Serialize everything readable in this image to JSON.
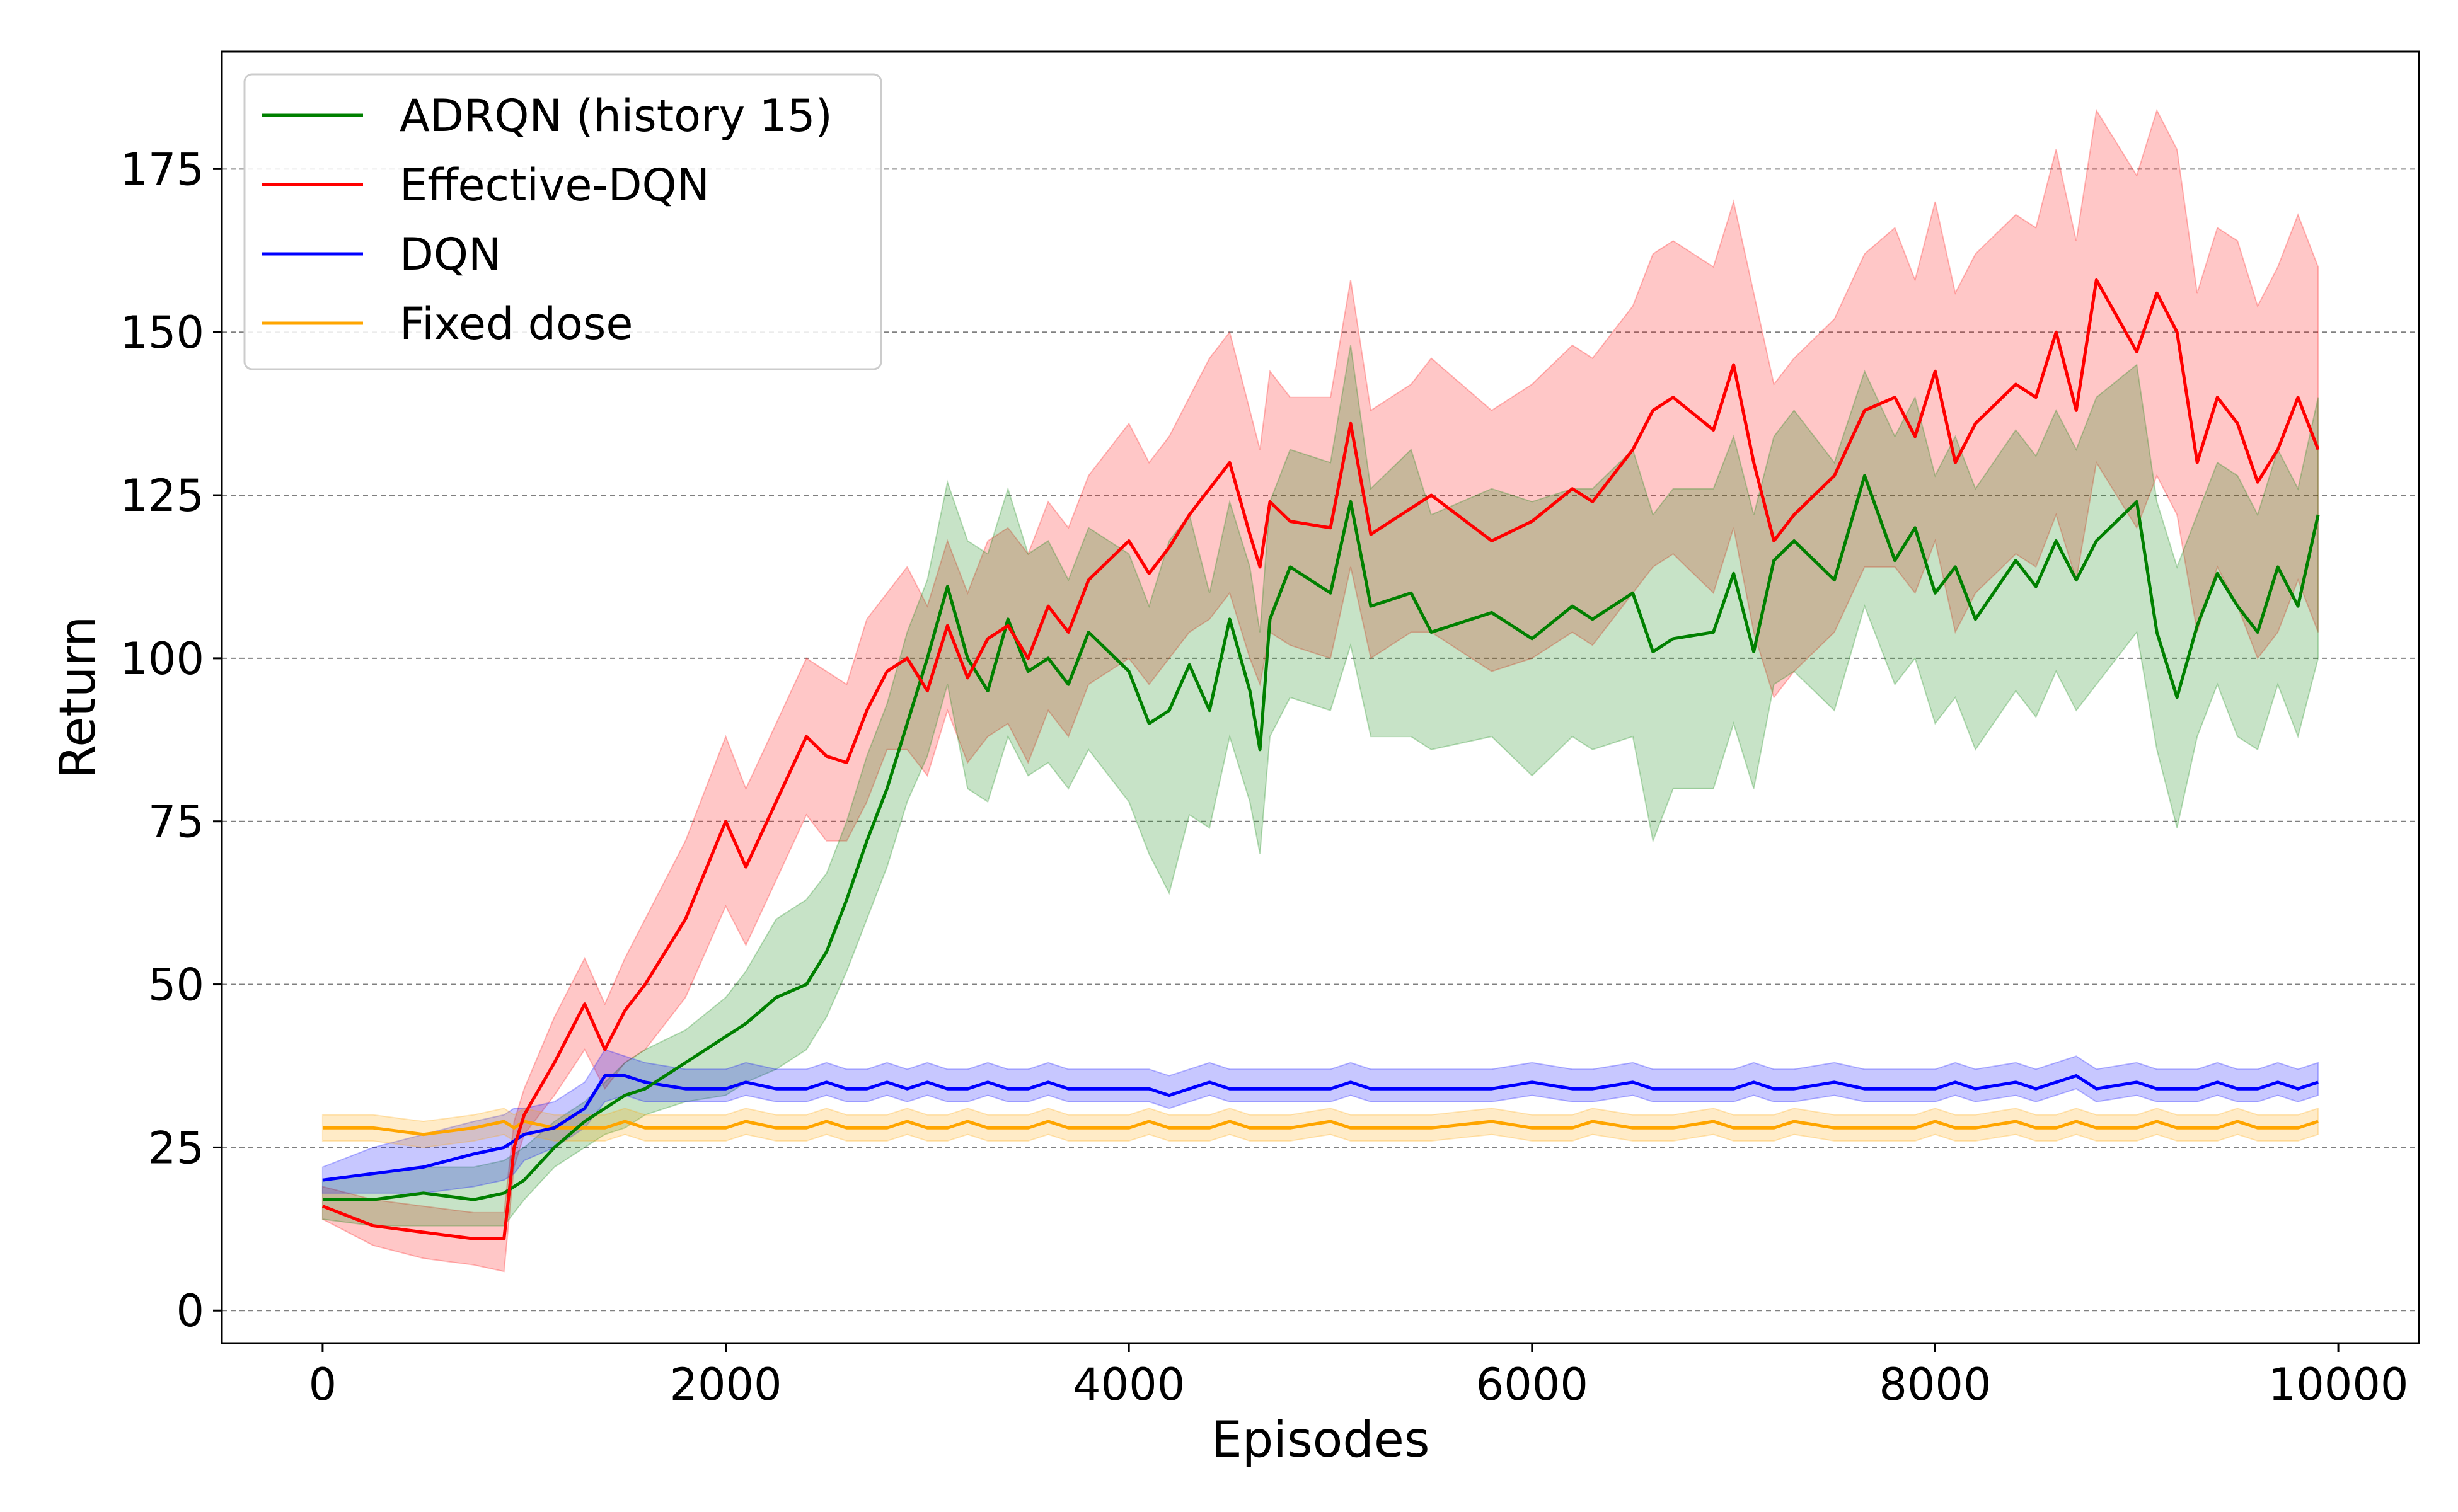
{
  "chart_data": {
    "type": "line",
    "title": "",
    "xlabel": "Episodes",
    "ylabel": "Return",
    "xlim": [
      -500,
      10400
    ],
    "ylim": [
      -5,
      193
    ],
    "xticks": [
      0,
      2000,
      4000,
      6000,
      8000,
      10000
    ],
    "xtick_labels": [
      "0",
      "2000",
      "4000",
      "6000",
      "8000",
      "10000"
    ],
    "yticks": [
      0,
      25,
      50,
      75,
      100,
      125,
      150,
      175
    ],
    "ytick_labels": [
      "0",
      "25",
      "50",
      "75",
      "100",
      "125",
      "150",
      "175"
    ],
    "grid": "horizontal dashed",
    "legend_position": "top-left",
    "x": [
      0,
      250,
      500,
      750,
      900,
      950,
      1000,
      1150,
      1300,
      1400,
      1500,
      1600,
      1800,
      2000,
      2100,
      2250,
      2400,
      2500,
      2600,
      2700,
      2800,
      2900,
      3000,
      3100,
      3200,
      3300,
      3400,
      3500,
      3600,
      3700,
      3800,
      4000,
      4100,
      4200,
      4300,
      4400,
      4500,
      4600,
      4650,
      4700,
      4800,
      5000,
      5100,
      5200,
      5400,
      5500,
      5800,
      6000,
      6200,
      6300,
      6500,
      6600,
      6700,
      6900,
      7000,
      7100,
      7200,
      7300,
      7500,
      7650,
      7800,
      7900,
      8000,
      8100,
      8200,
      8400,
      8500,
      8600,
      8700,
      8800,
      9000,
      9100,
      9200,
      9300,
      9400,
      9500,
      9600,
      9700,
      9800,
      9900
    ],
    "series": [
      {
        "name": "ADRQN (history 15)",
        "color": "#008000",
        "values": [
          17,
          17,
          18,
          17,
          18,
          19,
          20,
          25,
          29,
          31,
          33,
          34,
          38,
          42,
          44,
          48,
          50,
          55,
          63,
          72,
          80,
          90,
          100,
          111,
          100,
          95,
          106,
          98,
          100,
          96,
          104,
          98,
          90,
          92,
          99,
          92,
          106,
          95,
          86,
          106,
          114,
          110,
          124,
          108,
          110,
          104,
          107,
          103,
          108,
          106,
          110,
          101,
          103,
          104,
          113,
          101,
          115,
          118,
          112,
          128,
          115,
          120,
          110,
          114,
          106,
          115,
          111,
          118,
          112,
          118,
          124,
          104,
          94,
          105,
          113,
          108,
          104,
          114,
          108,
          122
        ],
        "lower": [
          14,
          13,
          13,
          13,
          13,
          15,
          17,
          22,
          25,
          27,
          28,
          30,
          32,
          33,
          35,
          37,
          40,
          45,
          52,
          60,
          68,
          78,
          85,
          96,
          80,
          78,
          88,
          82,
          84,
          80,
          86,
          78,
          70,
          64,
          76,
          74,
          88,
          78,
          70,
          88,
          94,
          92,
          102,
          88,
          88,
          86,
          88,
          82,
          88,
          86,
          88,
          72,
          80,
          80,
          90,
          80,
          96,
          98,
          92,
          108,
          96,
          100,
          90,
          94,
          86,
          95,
          91,
          98,
          92,
          96,
          104,
          86,
          74,
          88,
          96,
          88,
          86,
          96,
          88,
          100
        ],
        "upper": [
          20,
          21,
          22,
          22,
          23,
          24,
          25,
          29,
          32,
          35,
          38,
          40,
          43,
          48,
          52,
          60,
          63,
          67,
          75,
          85,
          93,
          104,
          112,
          127,
          118,
          116,
          126,
          116,
          118,
          112,
          120,
          116,
          108,
          118,
          122,
          110,
          124,
          114,
          104,
          124,
          132,
          130,
          148,
          126,
          132,
          122,
          126,
          124,
          126,
          126,
          132,
          122,
          126,
          126,
          134,
          122,
          134,
          138,
          130,
          144,
          134,
          140,
          128,
          134,
          126,
          135,
          131,
          138,
          132,
          140,
          145,
          124,
          114,
          122,
          130,
          128,
          122,
          132,
          126,
          140
        ]
      },
      {
        "name": "Effective-DQN",
        "color": "#ff0000",
        "values": [
          16,
          13,
          12,
          11,
          11,
          25,
          30,
          38,
          47,
          40,
          46,
          50,
          60,
          75,
          68,
          78,
          88,
          85,
          84,
          92,
          98,
          100,
          95,
          105,
          97,
          103,
          105,
          100,
          108,
          104,
          112,
          118,
          113,
          117,
          122,
          126,
          130,
          119,
          114,
          124,
          121,
          120,
          136,
          119,
          123,
          125,
          118,
          121,
          126,
          124,
          132,
          138,
          140,
          135,
          145,
          130,
          118,
          122,
          128,
          138,
          140,
          134,
          144,
          130,
          136,
          142,
          140,
          150,
          138,
          158,
          147,
          156,
          150,
          130,
          140,
          136,
          127,
          132,
          140,
          132
        ],
        "lower": [
          14,
          10,
          8,
          7,
          6,
          22,
          27,
          33,
          40,
          34,
          38,
          40,
          48,
          62,
          56,
          66,
          76,
          72,
          72,
          78,
          86,
          86,
          82,
          92,
          84,
          88,
          90,
          84,
          92,
          88,
          96,
          100,
          96,
          100,
          104,
          106,
          110,
          100,
          96,
          104,
          102,
          100,
          114,
          100,
          104,
          104,
          98,
          100,
          104,
          102,
          110,
          114,
          116,
          110,
          120,
          104,
          94,
          98,
          104,
          114,
          114,
          110,
          118,
          104,
          110,
          116,
          114,
          122,
          112,
          130,
          120,
          128,
          122,
          104,
          114,
          108,
          100,
          104,
          112,
          104
        ],
        "upper": [
          19,
          17,
          16,
          15,
          15,
          29,
          34,
          45,
          54,
          47,
          54,
          60,
          72,
          88,
          80,
          90,
          100,
          98,
          96,
          106,
          110,
          114,
          108,
          118,
          110,
          118,
          120,
          116,
          124,
          120,
          128,
          136,
          130,
          134,
          140,
          146,
          150,
          138,
          132,
          144,
          140,
          140,
          158,
          138,
          142,
          146,
          138,
          142,
          148,
          146,
          154,
          162,
          164,
          160,
          170,
          156,
          142,
          146,
          152,
          162,
          166,
          158,
          170,
          156,
          162,
          168,
          166,
          178,
          164,
          184,
          174,
          184,
          178,
          156,
          166,
          164,
          154,
          160,
          168,
          160
        ]
      },
      {
        "name": "DQN",
        "color": "#0000ff",
        "values": [
          20,
          21,
          22,
          24,
          25,
          26,
          27,
          28,
          31,
          36,
          36,
          35,
          34,
          34,
          35,
          34,
          34,
          35,
          34,
          34,
          35,
          34,
          35,
          34,
          34,
          35,
          34,
          34,
          35,
          34,
          34,
          34,
          34,
          33,
          34,
          35,
          34,
          34,
          34,
          34,
          34,
          34,
          35,
          34,
          34,
          34,
          34,
          35,
          34,
          34,
          35,
          34,
          34,
          34,
          34,
          35,
          34,
          34,
          35,
          34,
          34,
          34,
          34,
          35,
          34,
          35,
          34,
          35,
          36,
          34,
          35,
          34,
          34,
          34,
          35,
          34,
          34,
          35,
          34,
          35
        ],
        "lower": [
          18,
          18,
          18,
          19,
          20,
          21,
          23,
          25,
          28,
          32,
          33,
          32,
          32,
          32,
          33,
          32,
          32,
          33,
          32,
          32,
          33,
          32,
          33,
          32,
          32,
          33,
          32,
          32,
          33,
          32,
          32,
          32,
          32,
          31,
          32,
          33,
          32,
          32,
          32,
          32,
          32,
          32,
          33,
          32,
          32,
          32,
          32,
          33,
          32,
          32,
          33,
          32,
          32,
          32,
          32,
          33,
          32,
          32,
          33,
          32,
          32,
          32,
          32,
          33,
          32,
          33,
          32,
          33,
          34,
          32,
          33,
          32,
          32,
          32,
          33,
          32,
          32,
          33,
          32,
          33
        ],
        "upper": [
          22,
          25,
          27,
          29,
          30,
          31,
          31,
          32,
          35,
          40,
          39,
          38,
          37,
          37,
          38,
          37,
          37,
          38,
          37,
          37,
          38,
          37,
          38,
          37,
          37,
          38,
          37,
          37,
          38,
          37,
          37,
          37,
          37,
          36,
          37,
          38,
          37,
          37,
          37,
          37,
          37,
          37,
          38,
          37,
          37,
          37,
          37,
          38,
          37,
          37,
          38,
          37,
          37,
          37,
          37,
          38,
          37,
          37,
          38,
          37,
          37,
          37,
          37,
          38,
          37,
          38,
          37,
          38,
          39,
          37,
          38,
          37,
          37,
          37,
          38,
          37,
          37,
          38,
          37,
          38
        ]
      },
      {
        "name": "Fixed dose",
        "color": "#ffa500",
        "values": [
          28,
          28,
          27,
          28,
          29,
          28,
          29,
          28,
          28,
          28,
          29,
          28,
          28,
          28,
          29,
          28,
          28,
          29,
          28,
          28,
          28,
          29,
          28,
          28,
          29,
          28,
          28,
          28,
          29,
          28,
          28,
          28,
          29,
          28,
          28,
          28,
          29,
          28,
          28,
          28,
          28,
          29,
          28,
          28,
          28,
          28,
          29,
          28,
          28,
          29,
          28,
          28,
          28,
          29,
          28,
          28,
          28,
          29,
          28,
          28,
          28,
          28,
          29,
          28,
          28,
          29,
          28,
          28,
          29,
          28,
          28,
          29,
          28,
          28,
          28,
          29,
          28,
          28,
          28,
          29
        ],
        "lower": [
          26,
          26,
          25,
          26,
          27,
          26,
          27,
          26,
          26,
          26,
          27,
          26,
          26,
          26,
          27,
          26,
          26,
          27,
          26,
          26,
          26,
          27,
          26,
          26,
          27,
          26,
          26,
          26,
          27,
          26,
          26,
          26,
          27,
          26,
          26,
          26,
          27,
          26,
          26,
          26,
          26,
          27,
          26,
          26,
          26,
          26,
          27,
          26,
          26,
          27,
          26,
          26,
          26,
          27,
          26,
          26,
          26,
          27,
          26,
          26,
          26,
          26,
          27,
          26,
          26,
          27,
          26,
          26,
          27,
          26,
          26,
          27,
          26,
          26,
          26,
          27,
          26,
          26,
          26,
          27
        ],
        "upper": [
          30,
          30,
          29,
          30,
          31,
          30,
          31,
          30,
          30,
          30,
          31,
          30,
          30,
          30,
          31,
          30,
          30,
          31,
          30,
          30,
          30,
          31,
          30,
          30,
          31,
          30,
          30,
          30,
          31,
          30,
          30,
          30,
          31,
          30,
          30,
          30,
          31,
          30,
          30,
          30,
          30,
          31,
          30,
          30,
          30,
          30,
          31,
          30,
          30,
          31,
          30,
          30,
          30,
          31,
          30,
          30,
          30,
          31,
          30,
          30,
          30,
          30,
          31,
          30,
          30,
          31,
          30,
          30,
          31,
          30,
          30,
          31,
          30,
          30,
          30,
          31,
          30,
          30,
          30,
          31
        ]
      }
    ]
  }
}
